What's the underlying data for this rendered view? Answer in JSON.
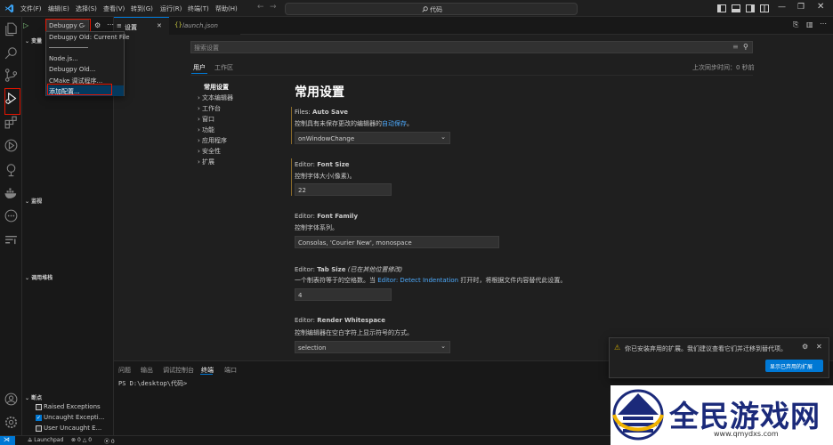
{
  "menu": [
    "文件(F)",
    "编辑(E)",
    "选择(S)",
    "查看(V)",
    "转到(G)",
    "运行(R)",
    "终端(T)",
    "帮助(H)"
  ],
  "command_center": {
    "text": "代码"
  },
  "sidebar": {
    "variables_header": "变量",
    "watch_header": "监视",
    "callstack_header": "调用堆栈",
    "breakpoints_header": "断点",
    "breakpoints": [
      {
        "label": "Raised Exceptions",
        "checked": false
      },
      {
        "label": "Uncaught Excepti...",
        "checked": true
      },
      {
        "label": "User Uncaught E...",
        "checked": false
      }
    ]
  },
  "debug_toolbar": {
    "config": "Debugpy C"
  },
  "dropdown": {
    "items": [
      "Debugpy Old: Current File",
      "Node.js...",
      "Debugpy Old...",
      "CMake 调试程序...",
      "添加配置..."
    ]
  },
  "tabs": [
    {
      "label": "设置",
      "active": true
    },
    {
      "label": "launch.json",
      "active": false
    }
  ],
  "settings": {
    "search_placeholder": "搜索设置",
    "scope_tabs": [
      "用户",
      "工作区"
    ],
    "last_sync": "上次同步时间：0 秒前",
    "toc": [
      "常用设置",
      "文本编辑器",
      "工作台",
      "窗口",
      "功能",
      "应用程序",
      "安全性",
      "扩展"
    ],
    "section_title": "常用设置",
    "items": [
      {
        "category": "Files: ",
        "name": "Auto Save",
        "note": "",
        "desc": "控制具有未保存更改的编辑器的",
        "link": "自动保存",
        "desc_tail": "。",
        "value": "onWindowChange",
        "kind": "select"
      },
      {
        "category": "Editor: ",
        "name": "Font Size",
        "note": "",
        "desc": "控制字体大小(像素)。",
        "link": "",
        "desc_tail": "",
        "value": "22",
        "kind": "input"
      },
      {
        "category": "Editor: ",
        "name": "Font Family",
        "note": "",
        "desc": "控制字体系列。",
        "link": "",
        "desc_tail": "",
        "value": "Consolas, 'Courier New', monospace",
        "kind": "input"
      },
      {
        "category": "Editor: ",
        "name": "Tab Size",
        "note": "(已在其他位置修改)",
        "desc": "一个制表符等于的空格数。当",
        "link": "Editor: Detect Indentation",
        "desc_tail": "打开时，将根据文件内容替代此设置。",
        "value": "4",
        "kind": "input"
      },
      {
        "category": "Editor: ",
        "name": "Render Whitespace",
        "note": "",
        "desc": "控制编辑器在空白字符上显示符号的方式。",
        "link": "",
        "desc_tail": "",
        "value": "selection",
        "kind": "select"
      }
    ]
  },
  "panel": {
    "tabs": [
      "问题",
      "输出",
      "调试控制台",
      "终端",
      "端口"
    ],
    "active_tab": "终端",
    "terminal_line": "PS D:\\desktop\\代码>"
  },
  "notification": {
    "text": "你已安装弃用的扩展。我们建议查看它们并迁移到替代项。",
    "button": "显示已弃用的扩展"
  },
  "statusbar": {
    "launchpad": "Launchpad",
    "errors": "0",
    "warnings": "0",
    "ports": "0"
  },
  "watermark": {
    "text": "全民游戏网",
    "url": "www.qmydxs.com"
  },
  "colors": {
    "accent": "#0078d4",
    "link": "#4daafc",
    "highlight_box": "#e51400"
  }
}
